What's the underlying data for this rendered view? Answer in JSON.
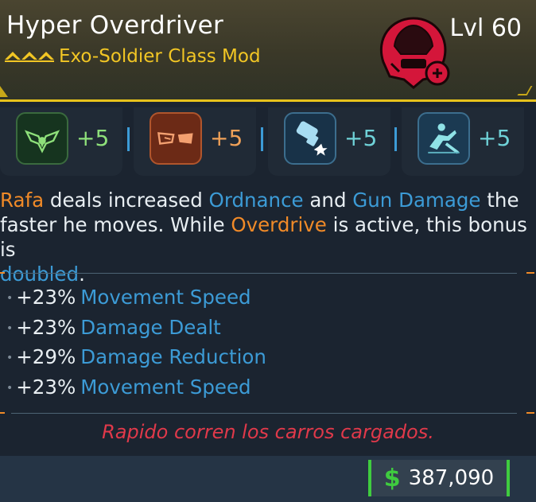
{
  "item": {
    "name": "Hyper Overdriver",
    "level": "Lvl 60",
    "class_mod": "Exo-Soldier Class Mod",
    "rarity_color": "#e7c21c",
    "class_icon": "red-soldier-helmet-icon"
  },
  "skills": [
    {
      "icon": "green-wings-skill-icon",
      "bonus": "+5",
      "color": "#8ee07a",
      "border": "#3a6a3e",
      "bg": "#16341f"
    },
    {
      "icon": "orange-wings-skill-icon",
      "bonus": "+5",
      "color": "#f0a158",
      "border": "#b0552c",
      "bg": "#6c2a16"
    },
    {
      "icon": "blue-gun-skill-icon",
      "bonus": "+5",
      "color": "#6fd2d8",
      "border": "#3c6e8e",
      "bg": "#183248"
    },
    {
      "icon": "blue-sliding-soldier-skill-icon",
      "bonus": "+5",
      "color": "#6fd2d8",
      "border": "#3c6e8e",
      "bg": "#1b3a52"
    }
  ],
  "description": {
    "s1": "Rafa",
    "s2": " deals increased ",
    "s3": "Ordnance",
    "s4": " and ",
    "s5": "Gun Damage",
    "s6": " the",
    "s7": "faster he moves. While ",
    "s8": "Overdrive",
    "s9": " is active, this bonus is",
    "s10": "doubled",
    "s11": "."
  },
  "stats": [
    {
      "value": "+23%",
      "label": "Movement Speed"
    },
    {
      "value": "+23%",
      "label": "Damage Dealt"
    },
    {
      "value": "+29%",
      "label": "Damage Reduction"
    },
    {
      "value": "+23%",
      "label": "Movement Speed"
    }
  ],
  "flavor_text": "Rapido corren los carros cargados.",
  "price": {
    "currency_icon": "dollar-icon",
    "currency_symbol": "$",
    "amount": "387,090"
  }
}
